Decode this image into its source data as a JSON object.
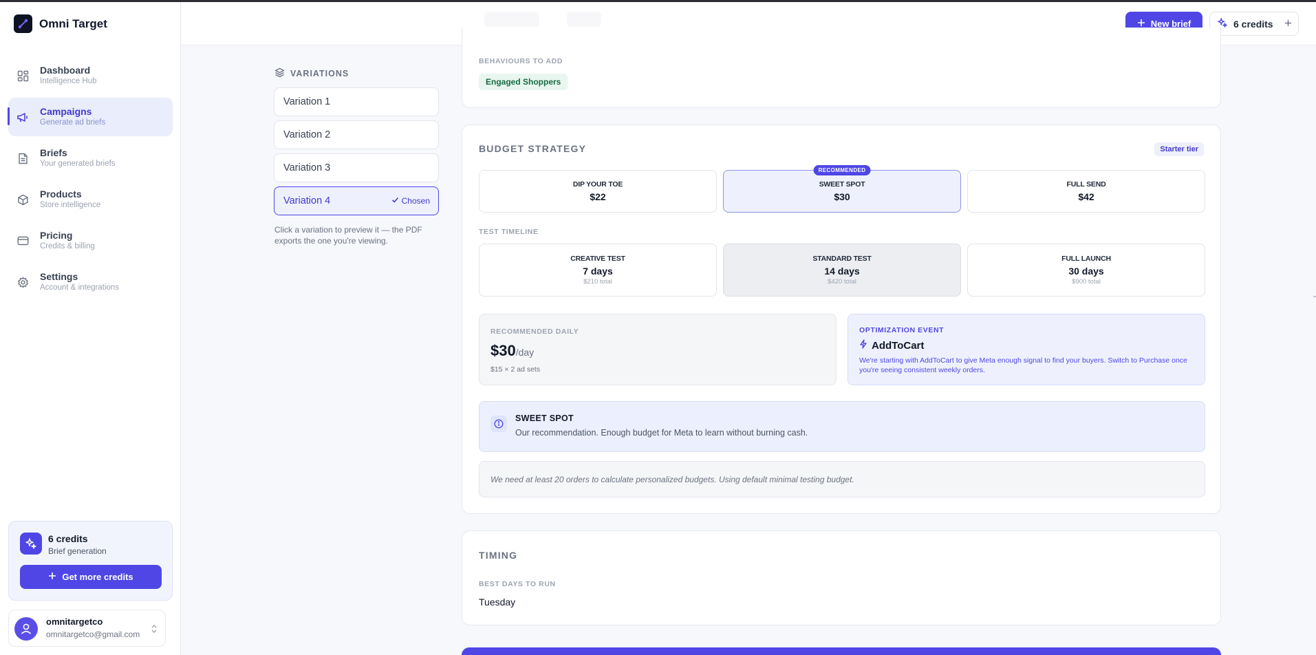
{
  "app": {
    "name": "Omni Target"
  },
  "sidebar": {
    "items": [
      {
        "label": "Dashboard",
        "sub": "Intelligence Hub"
      },
      {
        "label": "Campaigns",
        "sub": "Generate ad briefs"
      },
      {
        "label": "Briefs",
        "sub": "Your generated briefs"
      },
      {
        "label": "Products",
        "sub": "Store intelligence"
      },
      {
        "label": "Pricing",
        "sub": "Credits & billing"
      },
      {
        "label": "Settings",
        "sub": "Account & integrations"
      }
    ],
    "credits": {
      "title": "6 credits",
      "sub": "Brief generation",
      "button": "Get more credits"
    },
    "user": {
      "name": "omnitargetco",
      "email": "omnitargetco@gmail.com"
    }
  },
  "header": {
    "new_brief": "New brief",
    "credits": "6 credits"
  },
  "variations": {
    "heading": "VARIATIONS",
    "items": [
      "Variation 1",
      "Variation 2",
      "Variation 3",
      "Variation 4"
    ],
    "chosen_label": "Chosen",
    "help": "Click a variation to preview it — the PDF exports the one you're viewing."
  },
  "behaviours": {
    "label": "BEHAVIOURS TO ADD",
    "tags": [
      "Engaged Shoppers"
    ]
  },
  "budget": {
    "title": "BUDGET STRATEGY",
    "tier": "Starter tier",
    "options": [
      {
        "label": "DIP YOUR TOE",
        "value": "$22"
      },
      {
        "label": "SWEET SPOT",
        "value": "$30",
        "badge": "RECOMMENDED"
      },
      {
        "label": "FULL SEND",
        "value": "$42"
      }
    ],
    "timeline_label": "TEST TIMELINE",
    "timeline": [
      {
        "label": "CREATIVE TEST",
        "value": "7 days",
        "sub": "$210 total"
      },
      {
        "label": "STANDARD TEST",
        "value": "14 days",
        "sub": "$420 total"
      },
      {
        "label": "FULL LAUNCH",
        "value": "30 days",
        "sub": "$900 total"
      }
    ],
    "daily": {
      "label": "RECOMMENDED DAILY",
      "value": "$30",
      "unit": "/day",
      "sub": "$15 × 2 ad sets"
    },
    "event": {
      "label": "OPTIMIZATION EVENT",
      "name": "AddToCart",
      "desc": "We're starting with AddToCart to give Meta enough signal to find your buyers. Switch to Purchase once you're seeing consistent weekly orders."
    },
    "sweet": {
      "title": "SWEET SPOT",
      "desc": "Our recommendation. Enough budget for Meta to learn without burning cash."
    },
    "note": "We need at least 20 orders to calculate personalized budgets. Using default minimal testing budget."
  },
  "timing": {
    "title": "TIMING",
    "best_days_label": "BEST DAYS TO RUN",
    "best_days": "Tuesday"
  },
  "colors": {
    "accent": "#4f46e5",
    "accent_soft": "#eef1fd",
    "tag_green_bg": "#e8f6ef",
    "tag_green_text": "#166a43"
  }
}
